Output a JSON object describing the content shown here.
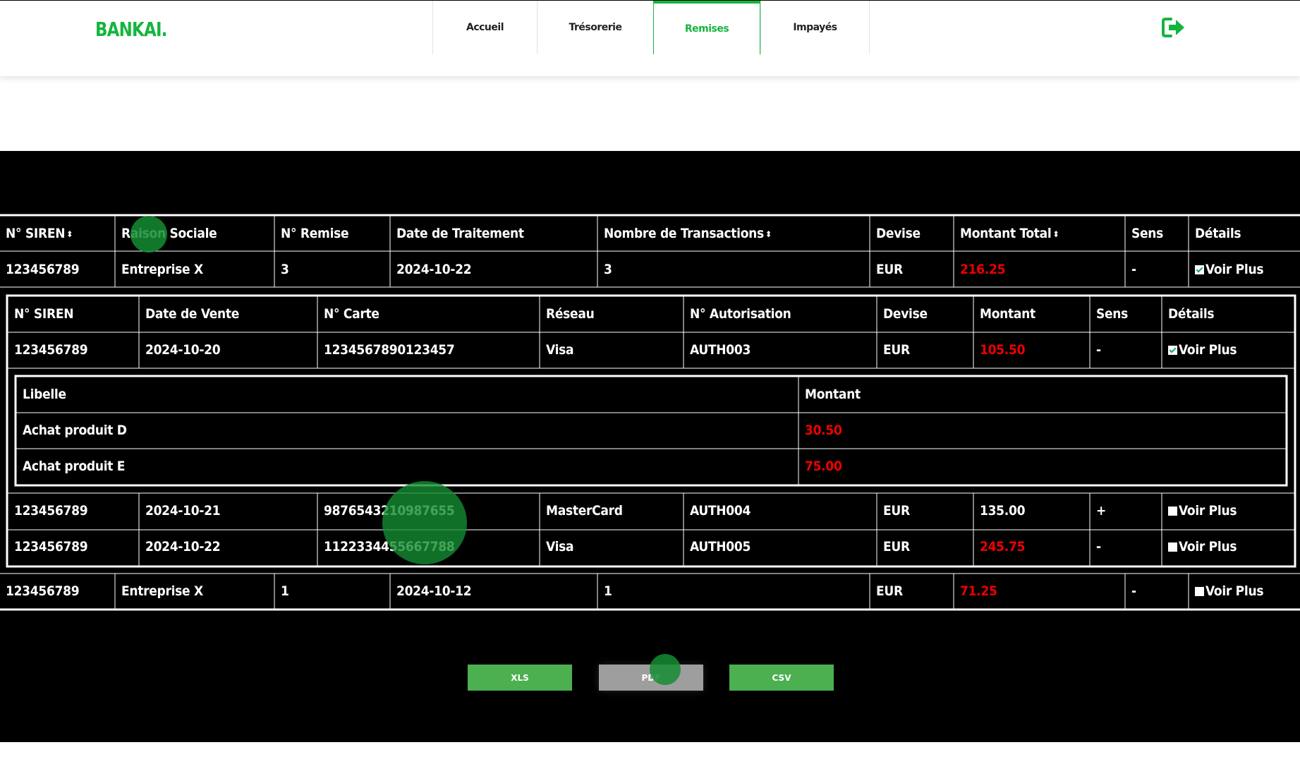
{
  "header": {
    "logo": "BANKAI.",
    "nav": [
      {
        "label": "Accueil",
        "active": false
      },
      {
        "label": "Trésorerie",
        "active": false
      },
      {
        "label": "Remises",
        "active": true
      },
      {
        "label": "Impayés",
        "active": false
      }
    ],
    "logout_icon": "sign-out-icon",
    "accent_color": "#14b53e"
  },
  "remises_table": {
    "columns": [
      "N° SIREN",
      "Raison Sociale",
      "N° Remise",
      "Date de Traitement",
      "Nombre de Transactions",
      "Devise",
      "Montant Total",
      "Sens",
      "Détails"
    ],
    "sortable": [
      "N° SIREN",
      "Nombre de Transactions",
      "Montant Total"
    ],
    "rows": [
      {
        "siren": "123456789",
        "raison": "Entreprise X",
        "remise": "3",
        "date": "2024-10-22",
        "nb": "3",
        "devise": "EUR",
        "montant": "216.25",
        "sens": "-",
        "details": "Voir Plus",
        "checked": true
      },
      {
        "siren": "123456789",
        "raison": "Entreprise X",
        "remise": "1",
        "date": "2024-10-12",
        "nb": "1",
        "devise": "EUR",
        "montant": "71.25",
        "sens": "-",
        "details": "Voir Plus",
        "checked": false
      }
    ]
  },
  "transactions_table": {
    "columns": [
      "N° SIREN",
      "Date de Vente",
      "N° Carte",
      "Réseau",
      "N° Autorisation",
      "Devise",
      "Montant",
      "Sens",
      "Détails"
    ],
    "rows": [
      {
        "siren": "123456789",
        "date": "2024-10-20",
        "carte": "1234567890123457",
        "reseau": "Visa",
        "auth": "AUTH003",
        "devise": "EUR",
        "montant": "105.50",
        "sens": "-",
        "details": "Voir Plus",
        "checked": true
      },
      {
        "siren": "123456789",
        "date": "2024-10-21",
        "carte": "9876543210987655",
        "reseau": "MasterCard",
        "auth": "AUTH004",
        "devise": "EUR",
        "montant": "135.00",
        "sens": "+",
        "details": "Voir Plus",
        "checked": false
      },
      {
        "siren": "123456789",
        "date": "2024-10-22",
        "carte": "1122334455667788",
        "reseau": "Visa",
        "auth": "AUTH005",
        "devise": "EUR",
        "montant": "245.75",
        "sens": "-",
        "details": "Voir Plus",
        "checked": false
      }
    ]
  },
  "libelle_table": {
    "columns": [
      "Libelle",
      "Montant"
    ],
    "rows": [
      {
        "libelle": "Achat produit D",
        "montant": "30.50"
      },
      {
        "libelle": "Achat produit E",
        "montant": "75.00"
      }
    ]
  },
  "export_buttons": [
    "XLS",
    "PDF",
    "CSV"
  ],
  "colors": {
    "negative": "#ee0000",
    "button_green": "#4caf50",
    "button_grey": "#9e9e9e"
  }
}
